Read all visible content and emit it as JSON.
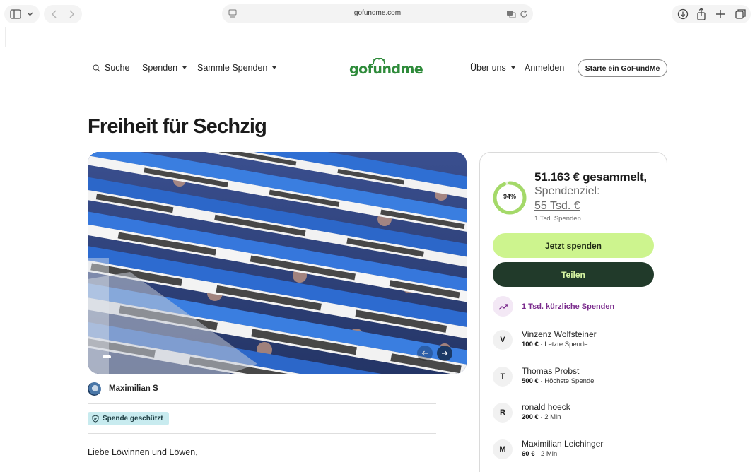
{
  "browser": {
    "url": "gofundme.com"
  },
  "nav": {
    "search_label": "Suche",
    "donate_label": "Spenden",
    "fundraise_label": "Sammle Spenden",
    "logo_text": "gofundme",
    "about_label": "Über uns",
    "login_label": "Anmelden",
    "start_label": "Starte ein GoFundMe"
  },
  "campaign": {
    "title": "Freiheit für Sechzig",
    "hero_image_icon": "photo-fans-holding-blue-white-scarves",
    "organizer": "Maximilian S",
    "badge": "Spende geschützt",
    "greeting": "Liebe Löwinnen und Löwen,"
  },
  "donation_card": {
    "progress_percent": 94,
    "progress_label": "94%",
    "raised": "51.163 € gesammelt,",
    "goal_label": "Spendenziel:",
    "goal_value": "55 Tsd. €",
    "donations_count": "1 Tsd. Spenden",
    "donate_button": "Jetzt spenden",
    "share_button": "Teilen",
    "recent_label": "1 Tsd. kürzliche Spenden",
    "donors": [
      {
        "initial": "V",
        "name": "Vinzenz Wolfsteiner",
        "amount": "100 €",
        "note": " · Letzte Spende"
      },
      {
        "initial": "T",
        "name": "Thomas Probst",
        "amount": "500 €",
        "note": " · Höchste Spende"
      },
      {
        "initial": "R",
        "name": "ronald hoeck",
        "amount": "200 €",
        "note": " · 2 Min"
      },
      {
        "initial": "M",
        "name": "Maximilian Leichinger",
        "amount": "60 €",
        "note": " · 2 Min"
      }
    ]
  },
  "colors": {
    "brand_green": "#2e8b3a",
    "donate_button": "#cdf48e",
    "share_button": "#213a2a",
    "ring_progress": "#a4d969",
    "recent_purple": "#7a2a8c"
  }
}
